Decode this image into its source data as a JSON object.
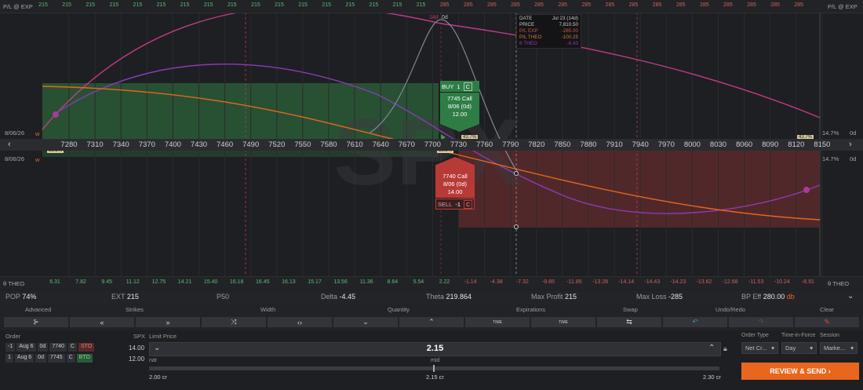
{
  "pl_label": "P/L @ EXP",
  "pl_values": [
    "215",
    "215",
    "215",
    "215",
    "215",
    "215",
    "215",
    "215",
    "215",
    "215",
    "215",
    "215",
    "215",
    "215",
    "215",
    "215",
    "215",
    "285",
    "285",
    "285",
    "285",
    "285",
    "285",
    "285",
    "285",
    "285",
    "285",
    "285",
    "285",
    "285",
    "285",
    "285",
    "285"
  ],
  "theo_label": "θ THEO",
  "theo_values": [
    "6.31",
    "7.82",
    "9.45",
    "11.12",
    "12.75",
    "14.21",
    "15.40",
    "16.18",
    "16.45",
    "16.13",
    "15.17",
    "13.56",
    "11.36",
    "8.64",
    "5.54",
    "2.22",
    "-1.14",
    "-4.38",
    "-7.32",
    "-9.85",
    "-11.85",
    "-13.28",
    "-14.14",
    "-14.43",
    "-14.23",
    "-13.62",
    "-12.68",
    "-11.53",
    "-10.24",
    "-8.91"
  ],
  "strikes": [
    "7280",
    "7310",
    "7340",
    "7370",
    "7400",
    "7430",
    "7460",
    "7490",
    "7520",
    "7550",
    "7580",
    "7610",
    "7640",
    "7670",
    "7700",
    "7730",
    "7760",
    "7790",
    "7820",
    "7850",
    "7880",
    "7910",
    "7940",
    "7970",
    "8000",
    "8030",
    "8060",
    "8090",
    "8120",
    "8150"
  ],
  "top_markers": {
    "a": "14d",
    "b": "0d"
  },
  "side": {
    "date_top": "8/06/26",
    "date_bottom": "8/06/26",
    "w": "w",
    "iv_top": "14.7%",
    "iv_bottom": "14.7%",
    "dte_top": "0d",
    "dte_bottom": "0d",
    "pct_left_top": "53.3%",
    "pct_left_bottom": "53.3%",
    "pct_right_top": "43.7%",
    "pct_right_bottom": "43.7%",
    "pct_mid_top": "43.7%",
    "pct_mid_bottom": "53.3%"
  },
  "tooltip": {
    "date_label": "DATE",
    "date": "Jul 23 (14d)",
    "price_label": "PRICE",
    "price": "7,810.50",
    "plexp_label": "P/L EXP",
    "plexp": "-285.00",
    "pltheo_label": "P/L THEO",
    "pltheo": "-100.25",
    "theta_label": "θ THEO",
    "theta": "-6.43"
  },
  "watermark": "SPX",
  "buy_leg": {
    "action": "BUY",
    "qty": "1",
    "type": "C",
    "name": "7745 Call",
    "exp": "8/06 (0d)",
    "price": "12.00"
  },
  "sell_leg": {
    "action": "SELL",
    "qty": "-1",
    "type": "C",
    "name": "7740 Call",
    "exp": "8/06 (0d)",
    "price": "14.00"
  },
  "stats": {
    "pop_k": "POP",
    "pop_v": "74%",
    "ext_k": "EXT",
    "ext_v": "215",
    "p50_k": "P50",
    "p50_v": "",
    "delta_k": "Delta",
    "delta_v": "-4.45",
    "theta_k": "Theta",
    "theta_v": "219.864",
    "maxp_k": "Max Profit",
    "maxp_v": "215",
    "maxl_k": "Max Loss",
    "maxl_v": "-285",
    "bp_k": "BP Eff",
    "bp_v": "280.00",
    "bp_unit": "db"
  },
  "toolbar_labels": {
    "advanced": "Advanced",
    "strikes": "Strikes",
    "width": "Width",
    "quantity": "Quantity",
    "expirations": "Expirations",
    "swap": "Swap",
    "undoredo": "Undo/Redo",
    "clear": "Clear"
  },
  "toolbar_small": {
    "time1": "TIME",
    "time2": "TIME"
  },
  "order": {
    "order_label": "Order",
    "spx_label": "SPX",
    "limit_label": "Limit Price",
    "legs": [
      {
        "qty": "-1",
        "exp": "Aug 6",
        "dte": "0d",
        "strike": "7740",
        "type": "C",
        "side": "STO",
        "spx": "14.00"
      },
      {
        "qty": "1",
        "exp": "Aug 6",
        "dte": "0d",
        "strike": "7745",
        "type": "C",
        "side": "BTO",
        "spx": "12.00"
      }
    ],
    "limit_price": "2.15",
    "nat_label": "nat",
    "mid_label": "mid",
    "nat_value": "2.00 cr",
    "mid_value": "2.15 cr",
    "far_value": "2.30 cr",
    "order_type_label": "Order Type",
    "order_type": "Net Cr...",
    "tif_label": "Time-in-Force",
    "tif": "Day",
    "session_label": "Session",
    "session": "Marke...",
    "review_label": "REVIEW & SEND"
  },
  "colors": {
    "green": "#2f7d46",
    "red": "#b83a37",
    "orange": "#e8661d",
    "magenta": "#c23a88",
    "purple": "#8c3ab8"
  }
}
